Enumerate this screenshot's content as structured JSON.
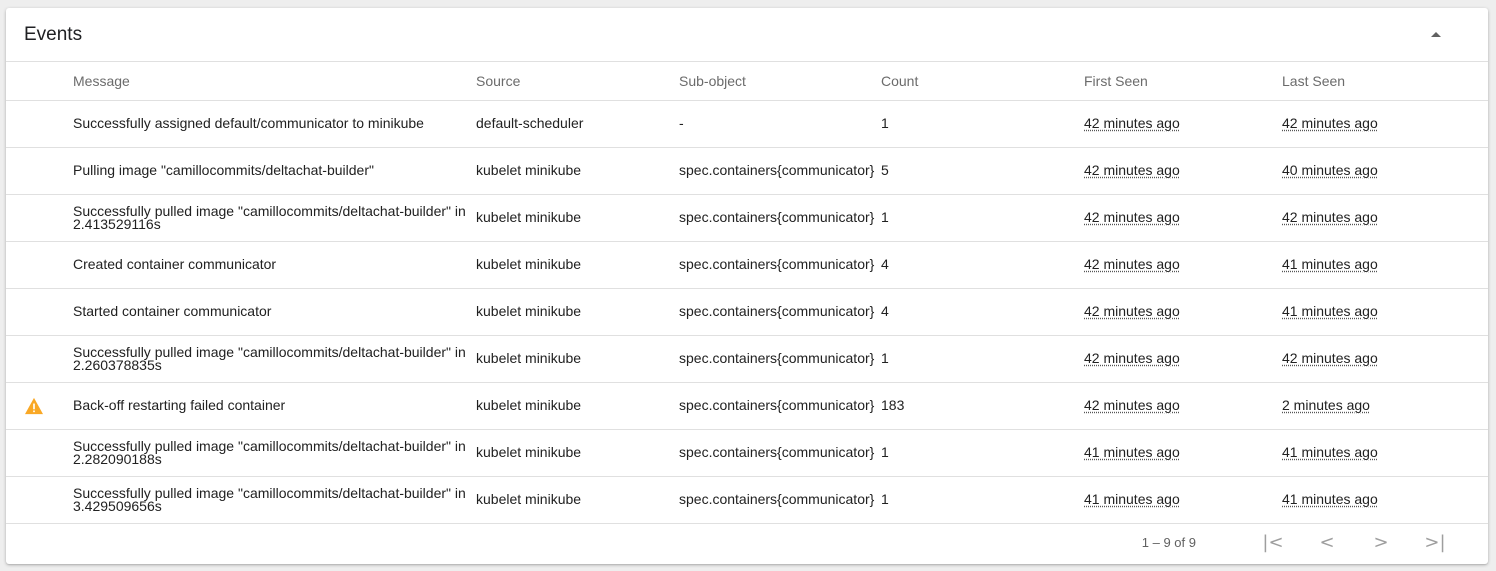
{
  "card": {
    "title": "Events"
  },
  "columns": {
    "message": "Message",
    "source": "Source",
    "subobject": "Sub-object",
    "count": "Count",
    "first_seen": "First Seen",
    "last_seen": "Last Seen"
  },
  "rows": [
    {
      "warning": false,
      "message": "Successfully assigned default/communicator to minikube",
      "source": "default-scheduler",
      "subobject": "-",
      "count": "1",
      "first_seen": "42 minutes ago",
      "last_seen": "42 minutes ago"
    },
    {
      "warning": false,
      "message": "Pulling image \"camillocommits/deltachat-builder\"",
      "source": "kubelet minikube",
      "subobject": "spec.containers{communicator}",
      "count": "5",
      "first_seen": "42 minutes ago",
      "last_seen": "40 minutes ago"
    },
    {
      "warning": false,
      "message": "Successfully pulled image \"camillocommits/deltachat-builder\" in 2.413529116s",
      "source": "kubelet minikube",
      "subobject": "spec.containers{communicator}",
      "count": "1",
      "first_seen": "42 minutes ago",
      "last_seen": "42 minutes ago"
    },
    {
      "warning": false,
      "message": "Created container communicator",
      "source": "kubelet minikube",
      "subobject": "spec.containers{communicator}",
      "count": "4",
      "first_seen": "42 minutes ago",
      "last_seen": "41 minutes ago"
    },
    {
      "warning": false,
      "message": "Started container communicator",
      "source": "kubelet minikube",
      "subobject": "spec.containers{communicator}",
      "count": "4",
      "first_seen": "42 minutes ago",
      "last_seen": "41 minutes ago"
    },
    {
      "warning": false,
      "message": "Successfully pulled image \"camillocommits/deltachat-builder\" in 2.260378835s",
      "source": "kubelet minikube",
      "subobject": "spec.containers{communicator}",
      "count": "1",
      "first_seen": "42 minutes ago",
      "last_seen": "42 minutes ago"
    },
    {
      "warning": true,
      "message": "Back-off restarting failed container",
      "source": "kubelet minikube",
      "subobject": "spec.containers{communicator}",
      "count": "183",
      "first_seen": "42 minutes ago",
      "last_seen": "2 minutes ago"
    },
    {
      "warning": false,
      "message": "Successfully pulled image \"camillocommits/deltachat-builder\" in 2.282090188s",
      "source": "kubelet minikube",
      "subobject": "spec.containers{communicator}",
      "count": "1",
      "first_seen": "41 minutes ago",
      "last_seen": "41 minutes ago"
    },
    {
      "warning": false,
      "message": "Successfully pulled image \"camillocommits/deltachat-builder\" in 3.429509656s",
      "source": "kubelet minikube",
      "subobject": "spec.containers{communicator}",
      "count": "1",
      "first_seen": "41 minutes ago",
      "last_seen": "41 minutes ago"
    }
  ],
  "paginator": {
    "range_label": "1 – 9 of 9",
    "icons": {
      "first": "first-page-icon",
      "prev": "chevron-left-icon",
      "next": "chevron-right-icon",
      "last": "last-page-icon"
    }
  },
  "colors": {
    "warning": "#f9a825",
    "divider": "#e0e0e0",
    "header_text": "#6b6b6b"
  }
}
